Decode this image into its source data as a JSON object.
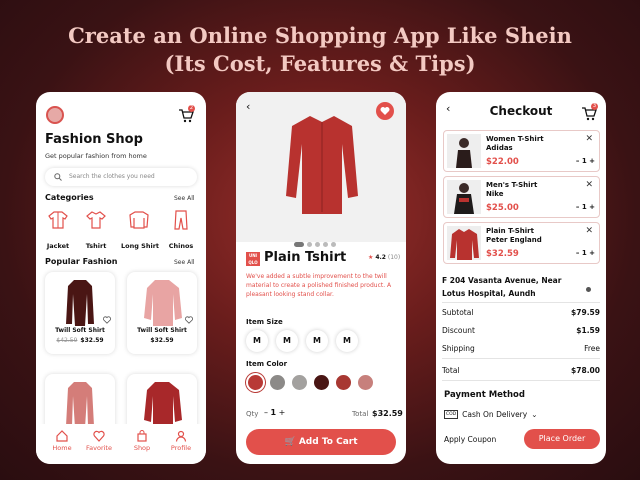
{
  "banner": {
    "line1": "Create an Online Shopping App Like Shein",
    "line2": "(Its Cost, Features & Tips)"
  },
  "colors": {
    "accent": "#e2504b",
    "background": "#6a1d1c",
    "title": "#f3c9c2"
  },
  "home": {
    "title": "Fashion Shop",
    "subtitle": "Get popular fashion from home",
    "cart_badge": "2",
    "search_placeholder": "Search the clothes you need",
    "categories_title": "Categories",
    "categories_see_all": "See All",
    "categories": [
      {
        "label": "Jacket",
        "icon": "jacket-icon"
      },
      {
        "label": "Tshirt",
        "icon": "tshirt-icon"
      },
      {
        "label": "Long Shirt",
        "icon": "long-shirt-icon"
      },
      {
        "label": "Chinos",
        "icon": "chinos-icon"
      }
    ],
    "popular_title": "Popular Fashion",
    "popular_see_all": "See All",
    "products": [
      {
        "name": "Twill Soft Shirt",
        "old_price": "$42.59",
        "price": "$32.59"
      },
      {
        "name": "Twill Soft Shirt",
        "old_price": "",
        "price": "$32.59"
      }
    ],
    "nav": [
      {
        "label": "Home",
        "icon": "home-icon"
      },
      {
        "label": "Favorite",
        "icon": "heart-icon"
      },
      {
        "label": "Shop",
        "icon": "shop-icon"
      },
      {
        "label": "Profile",
        "icon": "profile-icon"
      }
    ]
  },
  "product": {
    "brand": "UNI QLO",
    "name": "Plain Tshirt",
    "rating": "4.2",
    "reviews": "(10)",
    "description": "We've added a subtle improvement to the twill material to create a polished finished product. A pleasant looking stand collar.",
    "size_label": "Item Size",
    "sizes": [
      "M",
      "M",
      "M",
      "M"
    ],
    "color_label": "Item Color",
    "colors": [
      "#b83a36",
      "#8c8a88",
      "#a3a19f",
      "#4a1614",
      "#a83832",
      "#c7807c"
    ],
    "qty_label": "Qty",
    "qty": "1",
    "total_label": "Total",
    "total": "$32.59",
    "add_to_cart": "Add To Cart"
  },
  "checkout": {
    "title": "Checkout",
    "cart_badge": "3",
    "items": [
      {
        "name1": "Women T-Shirt",
        "name2": "Adidas",
        "price": "$22.00",
        "qty": "1"
      },
      {
        "name1": "Men's T-Shirt",
        "name2": "Nike",
        "price": "$25.00",
        "qty": "1"
      },
      {
        "name1": "Plain T-Shirt",
        "name2": "Peter England",
        "price": "$32.59",
        "qty": "1"
      }
    ],
    "address": "F 204 Vasanta Avenue, Near Lotus Hospital, Aundh",
    "rows": [
      {
        "label": "Subtotal",
        "value": "$79.59"
      },
      {
        "label": "Discount",
        "value": "$1.59"
      },
      {
        "label": "Shipping",
        "value": "Free"
      }
    ],
    "total_label": "Total",
    "total": "$78.00",
    "payment_title": "Payment Method",
    "payment_method": "Cash On Delivery",
    "payment_icon_text": "COD",
    "coupon": "Apply Coupon",
    "place_order": "Place Order"
  }
}
